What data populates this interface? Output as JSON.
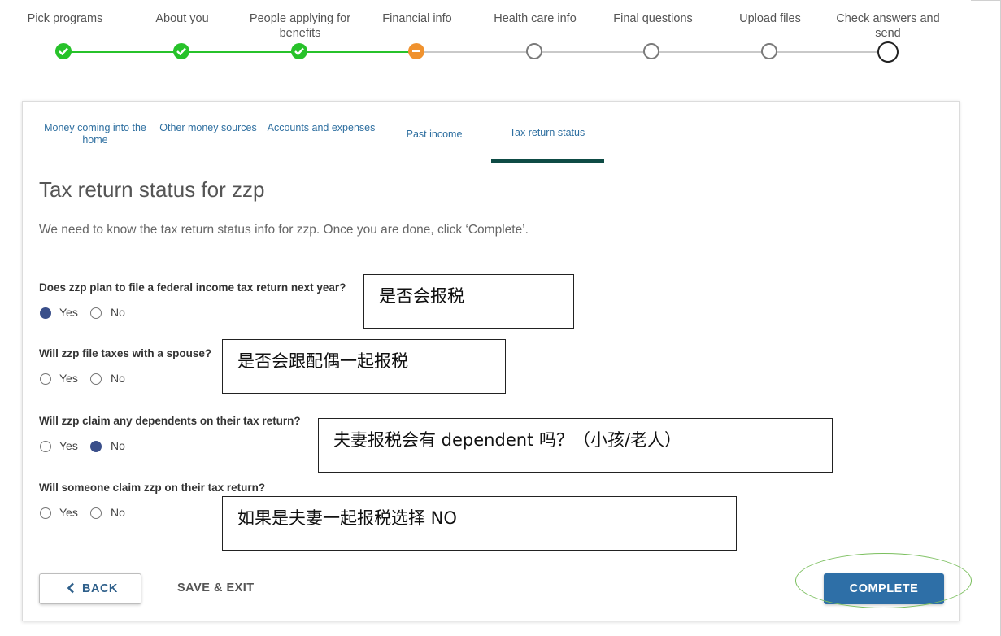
{
  "stepper": {
    "steps": [
      {
        "label": "Pick programs",
        "state": "done"
      },
      {
        "label": "About you",
        "state": "done"
      },
      {
        "label": "People applying for benefits",
        "state": "done"
      },
      {
        "label": "Financial info",
        "state": "current"
      },
      {
        "label": "Health care info",
        "state": "todo"
      },
      {
        "label": "Final questions",
        "state": "todo"
      },
      {
        "label": "Upload files",
        "state": "todo"
      },
      {
        "label": "Check answers and send",
        "state": "todo"
      }
    ]
  },
  "subtabs": [
    {
      "label": "Money coming into the home"
    },
    {
      "label": "Other money sources"
    },
    {
      "label": "Accounts and expenses"
    },
    {
      "label": "Past income"
    },
    {
      "label": "Tax return status",
      "active": true
    }
  ],
  "page": {
    "title": "Tax return status for zzp",
    "subtitle": "We need to know the tax return status info for zzp. Once you are done, click ‘Complete’."
  },
  "questions": [
    {
      "text": "Does zzp plan to file a federal income tax return next year?",
      "yes_label": "Yes",
      "no_label": "No",
      "selected": "yes"
    },
    {
      "text": "Will zzp file taxes with a spouse?",
      "yes_label": "Yes",
      "no_label": "No",
      "selected": null
    },
    {
      "text": "Will zzp claim any dependents on their tax return?",
      "yes_label": "Yes",
      "no_label": "No",
      "selected": "no"
    },
    {
      "text": "Will someone claim zzp on their tax return?",
      "yes_label": "Yes",
      "no_label": "No",
      "selected": null
    }
  ],
  "annotations": [
    "是否会报税",
    "是否会跟配偶一起报税",
    "夫妻报税会有 dependent 吗？（小孩/老人）",
    "如果是夫妻一起报税选择 NO"
  ],
  "footer": {
    "back_label": "BACK",
    "save_exit_label": "SAVE & EXIT",
    "complete_label": "COMPLETE"
  },
  "colors": {
    "done": "#27c22a",
    "current": "#f0922e",
    "accent": "#2e6fa7",
    "tab_underline": "#0e4b45",
    "radio_checked": "#3a4f8a"
  }
}
